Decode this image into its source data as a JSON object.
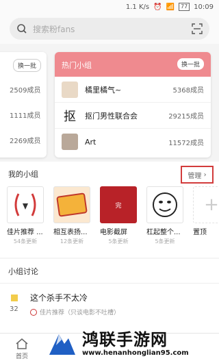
{
  "status_bar": {
    "speed": "1.1 K/s",
    "battery": "77",
    "time": "10:09"
  },
  "search": {
    "placeholder": "搜索粉fans"
  },
  "left_card": {
    "button": "换一批",
    "rows": [
      {
        "count": "2509成员"
      },
      {
        "count": "1111成员"
      },
      {
        "count": "2269成员"
      }
    ]
  },
  "hot_groups": {
    "title": "热门小组",
    "button": "换一批",
    "rows": [
      {
        "name": "橘里橘气~",
        "count": "5368成员"
      },
      {
        "name": "抠门男性联合会",
        "count": "29215成员",
        "avatar_glyph": "抠"
      },
      {
        "name": "Art",
        "count": "11572成员"
      }
    ]
  },
  "my_groups": {
    "title": "我的小组",
    "manage": "管理",
    "items": [
      {
        "label": "佳片推荐 ...",
        "sub": "54条更新"
      },
      {
        "label": "相互表扬...",
        "sub": "12条更新"
      },
      {
        "label": "电影截屏",
        "sub": "5条更新",
        "badge": "完"
      },
      {
        "label": "杠起整个...",
        "sub": "5条更新"
      },
      {
        "label": "置顶"
      }
    ]
  },
  "discussion": {
    "title": "小组讨论",
    "post": {
      "title": "这个杀手不太冷",
      "count": "32",
      "meta": "佳片推荐（只谈电影不吐槽）"
    }
  },
  "tabbar": {
    "home": "首页"
  },
  "overlay": {
    "brand": "鸿联手游网",
    "url": "www.henanhonglian95.com"
  }
}
